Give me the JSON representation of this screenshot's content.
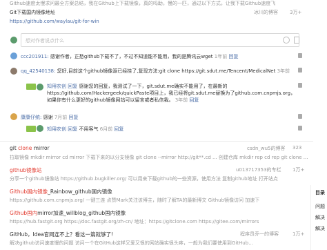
{
  "top": {
    "line1": "Github速度太慢求问最全方案总结，我在Github上下载镜像，真的吗助，慢的一匹，通过以下方式，让我下载Github速度飞",
    "line2": "Git下载国内镜像地址",
    "line2_meta": "冰川的博客",
    "line2_count": "3万+",
    "line3_url": "https://github.com/waylau/git-for-win"
  },
  "comment_input": {
    "placeholder": "想对作者说点什么"
  },
  "comments": [
    {
      "user": "ccc201911:",
      "text": "感谢作者，正愁github下载不了，不过不知道能不能用，我的是腾讯云wget",
      "time": "1年前",
      "reply": "回复"
    },
    {
      "user": "qq_42540138:",
      "text": "您好,目前这个github镜像源已经挂了,复现方法:git clone https://git.sdut.me/Tencent/MedicalNet",
      "time": "3年前",
      "reply": "",
      "sub": [
        {
          "badge": "知用农创",
          "reply_to": "回复",
          "text": "感谢您的回复，我测试了一下，git.sdut.me确实不能用了，在最新的https://github.com/Hackergeek/quickPaste项目上，我已经将git.sdut.me替换为了github.com.cnpmjs.org，如果你有什么更好的github镜像网站可以留言或者私信我。",
          "time": "3年前",
          "reply": "回复"
        }
      ]
    },
    {
      "user": "康康仔统:",
      "text": "感谢",
      "time": "7月前",
      "reply": "回复",
      "sub": [
        {
          "badge": "知用农创",
          "reply_to": "回复",
          "text": "不用客气",
          "time": "6月前",
          "reply": "回复"
        }
      ]
    }
  ],
  "related": [
    {
      "title_plain": "git ",
      "title_hl": "clone",
      "title_rest": " mirror",
      "meta": "csdn_wu5的博客",
      "count": "323",
      "desc": "拉取镜像 mkdir mirror cd mirror 下载下来的以分支镜像 git clone --mirror http://git**.cd ... 创建仓库 mkdir rep cd rep git clone ..."
    },
    {
      "title_plain": "",
      "title_hl": "github镜像站",
      "title_rest": "",
      "meta": "u013717353的专栏",
      "count": "1万+",
      "desc": "分享一个github镜像站 https://github.bugkiller.org/ 可以用来下载github的一些资源，使用方法 复制github地址 打开站点"
    },
    {
      "title_plain": "",
      "title_hl": "Github国内镜像",
      "title_rest": "_Rainbow_github国内镜像",
      "meta": "",
      "count": "",
      "desc": "https://github.com.cnpmjs.org/ 一键三连 点赞Mark关注该博主，随时了解TA的最新博文 Github镜像访问 加速下"
    },
    {
      "title_plain": "",
      "title_hl": "Github国内",
      "title_rest": "mirror加速_willblog_github国内镜像",
      "meta": "",
      "count": "",
      "desc": "https://hub.fastgit.org https://doc.fastgit.org/zh-cn/ 地址：https://gitclone.com https://gitee.com/mirrors"
    },
    {
      "title_plain": "GitHub，Idea官网连不上？看这一篇就够了!",
      "title_hl": "",
      "title_rest": "",
      "meta": "程序员乔一的博客",
      "count": "1万+",
      "desc": "解决github访问速度慢的问题 访问一个在GitHub这样又爱又恨的网站确实很头疼，一般为我们要使用到GitHub..."
    }
  ],
  "sidebar": {
    "title": "目录",
    "items": [
      "问题",
      "解决",
      "解决"
    ]
  }
}
